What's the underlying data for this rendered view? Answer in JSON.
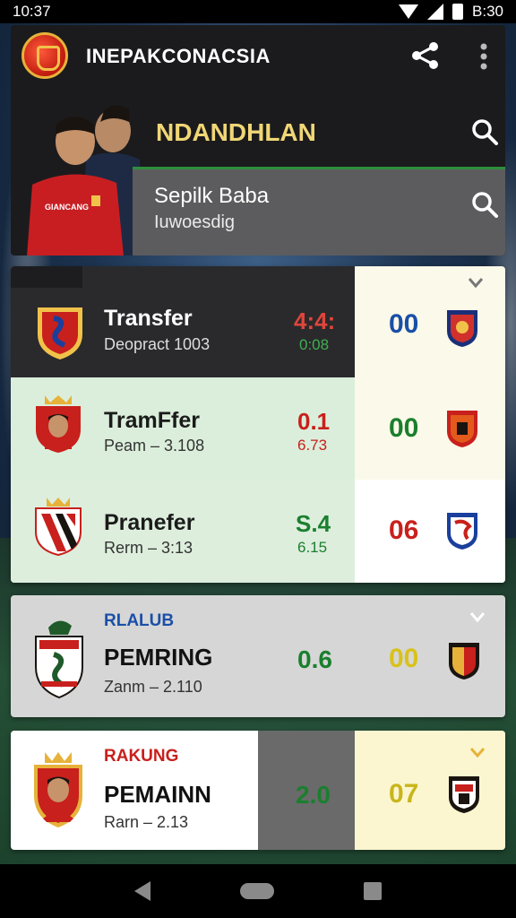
{
  "status_bar": {
    "time": "10:37",
    "right_time": "B:30"
  },
  "app_bar": {
    "title": "INEPAKCONACSIA"
  },
  "search": {
    "primary_text": "NDANDHLAN",
    "secondary_title": "Sepilk Baba",
    "secondary_subtitle": "Iuwoesdig"
  },
  "jersey_text": "GIANCANG",
  "group1": {
    "rows": [
      {
        "title": "Transfer",
        "subtitle": "Deopract 1003",
        "score_main": "4:4:",
        "score_sub": "0:08",
        "right_score": "00"
      },
      {
        "title": "TramFfer",
        "subtitle": "Peam – 3.108",
        "score_main": "0.1",
        "score_sub": "6.73",
        "right_score": "00"
      },
      {
        "title": "Pranefer",
        "subtitle": "Rerm – 3:13",
        "score_main": "S.4",
        "score_sub": "6.15",
        "right_score": "06"
      }
    ]
  },
  "group2": {
    "label": "RLALUB",
    "title": "PEMRING",
    "subtitle": "Zanm – 2.110",
    "score_main": "0.6",
    "right_score": "00"
  },
  "group3": {
    "label": "RAKUNG",
    "title": "PEMAINN",
    "subtitle": "Rarn – 2.13",
    "score_main": "2.0",
    "right_score": "07"
  },
  "colors": {
    "accent_red": "#d02a2a",
    "accent_green": "#1a7f2e",
    "accent_blue": "#1a4fa8",
    "accent_yellow": "#d9c21a"
  }
}
